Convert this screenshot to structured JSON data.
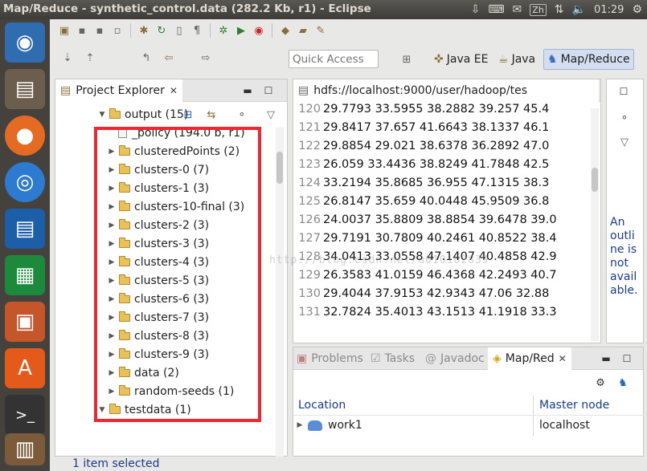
{
  "window": {
    "title": "Map/Reduce - synthetic_control.data (282.2 Kb, r1) - Eclipse"
  },
  "system_tray": {
    "input_method": "Zh",
    "time": "01:29"
  },
  "launcher": {
    "apps": [
      {
        "icon": "ubuntu-dash-icon",
        "color": "#2f6db0"
      },
      {
        "icon": "file-manager-icon",
        "color": "#6b5e4c"
      },
      {
        "icon": "firefox-icon",
        "color": "#e66b22"
      },
      {
        "icon": "chromium-icon",
        "color": "#2c7bd1"
      },
      {
        "icon": "writer-icon",
        "color": "#1c5ea8"
      },
      {
        "icon": "calc-icon",
        "color": "#1c8a3a"
      },
      {
        "icon": "impress-icon",
        "color": "#c4562a"
      },
      {
        "icon": "software-center-icon",
        "color": "#e35a1b"
      },
      {
        "icon": "terminal-icon",
        "color": "#333333"
      },
      {
        "icon": "workspace-switcher-icon",
        "color": "#7b5b3a"
      }
    ]
  },
  "toolbar": {
    "quick_access_placeholder": "Quick Access",
    "perspectives": [
      {
        "label": "Java EE"
      },
      {
        "label": "Java"
      },
      {
        "label": "Map/Reduce",
        "active": true
      }
    ]
  },
  "project_explorer": {
    "tab_label": "Project Explorer",
    "tree": [
      {
        "label": "output (15)",
        "type": "folder",
        "expanded": true,
        "indent": 0
      },
      {
        "label": "_policy (194.0 b, r1)",
        "type": "file",
        "indent": 1
      },
      {
        "label": "clusteredPoints (2)",
        "type": "folder",
        "indent": 1
      },
      {
        "label": "clusters-0 (7)",
        "type": "folder",
        "indent": 1
      },
      {
        "label": "clusters-1 (3)",
        "type": "folder",
        "indent": 1
      },
      {
        "label": "clusters-10-final (3)",
        "type": "folder",
        "indent": 1
      },
      {
        "label": "clusters-2 (3)",
        "type": "folder",
        "indent": 1
      },
      {
        "label": "clusters-3 (3)",
        "type": "folder",
        "indent": 1
      },
      {
        "label": "clusters-4 (3)",
        "type": "folder",
        "indent": 1
      },
      {
        "label": "clusters-5 (3)",
        "type": "folder",
        "indent": 1
      },
      {
        "label": "clusters-6 (3)",
        "type": "folder",
        "indent": 1
      },
      {
        "label": "clusters-7 (3)",
        "type": "folder",
        "indent": 1
      },
      {
        "label": "clusters-8 (3)",
        "type": "folder",
        "indent": 1
      },
      {
        "label": "clusters-9 (3)",
        "type": "folder",
        "indent": 1
      },
      {
        "label": "data (2)",
        "type": "folder",
        "indent": 1
      },
      {
        "label": "random-seeds (1)",
        "type": "folder",
        "indent": 1
      },
      {
        "label": "testdata (1)",
        "type": "folder",
        "expanded": true,
        "indent": 0
      }
    ]
  },
  "editor": {
    "tab_label": "hdfs://localhost:9000/user/hadoop/tes",
    "lines": [
      {
        "num": "120",
        "text": "29.7793 33.5955 38.2882 39.257  45.4"
      },
      {
        "num": "121",
        "text": "29.8417 37.657  41.6643 38.1337 46.1"
      },
      {
        "num": "122",
        "text": "29.8854 29.021  38.6378 36.2892 47.0"
      },
      {
        "num": "123",
        "text": "26.059  33.4436 38.8249 41.7848 42.5"
      },
      {
        "num": "124",
        "text": "33.2194 35.8685 36.955  47.1315 38.3"
      },
      {
        "num": "125",
        "text": "26.8147 35.659  40.0448 45.9509 36.8"
      },
      {
        "num": "126",
        "text": "24.0037 35.8809 38.8854 39.6478 39.0"
      },
      {
        "num": "127",
        "text": "29.7191 30.7809 40.2461 40.8522 38.4"
      },
      {
        "num": "128",
        "text": "34.0413 33.0558 47.1407 40.4858 42.9"
      },
      {
        "num": "129",
        "text": "26.3583 41.0159 46.4368 42.2493 40.7"
      },
      {
        "num": "130",
        "text": "29.4044 37.9153 42.9343 47.06   32.88"
      },
      {
        "num": "131",
        "text": "32.7824 35.4013 43.1513 41.1918 33.3"
      }
    ],
    "watermark": "http://blog.csdn.net/u010102839"
  },
  "outline": {
    "message": "An outline is not available."
  },
  "bottom_panel": {
    "tabs": [
      {
        "label": "Problems",
        "icon": "problems-icon"
      },
      {
        "label": "Tasks",
        "icon": "tasks-icon"
      },
      {
        "label": "Javadoc",
        "icon": "javadoc-icon"
      },
      {
        "label": "Map/Red",
        "icon": "mapreduce-icon",
        "active": true
      }
    ],
    "columns": [
      "Location",
      "Master node"
    ],
    "rows": [
      {
        "location": "work1",
        "master": "localhost"
      }
    ]
  },
  "status_bar": {
    "text": "1 item selected"
  }
}
